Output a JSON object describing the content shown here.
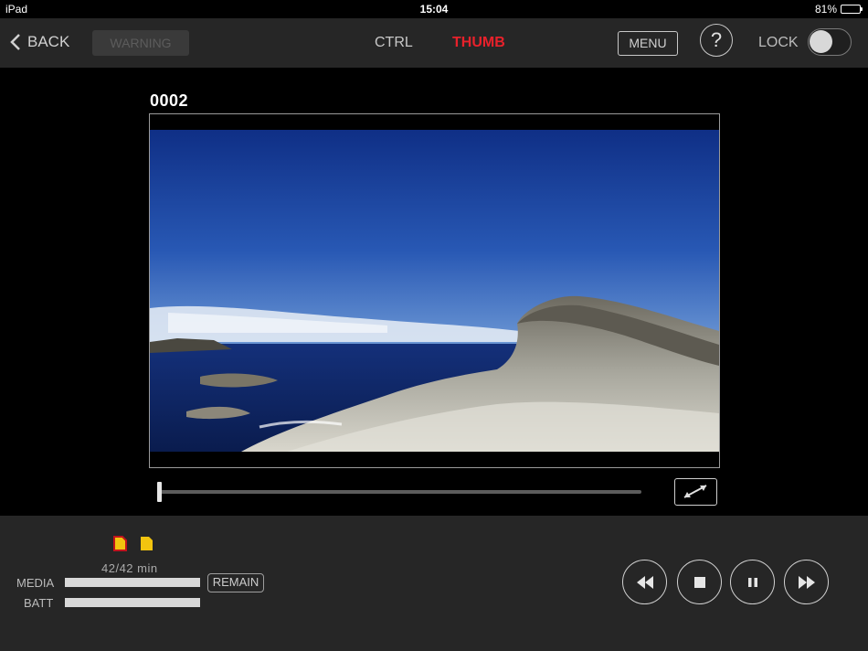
{
  "status_bar": {
    "device": "iPad",
    "time": "15:04",
    "battery_percent": "81%",
    "battery_level": 0.81
  },
  "nav": {
    "back_label": "BACK",
    "warning_label": "WARNING",
    "tabs": [
      {
        "label": "CTRL",
        "active": false
      },
      {
        "label": "THUMB",
        "active": true
      }
    ],
    "menu_label": "MENU",
    "help_label": "?",
    "lock_label": "LOCK",
    "lock_on": false
  },
  "clip": {
    "name": "0002",
    "playback_position": 0.0
  },
  "media": {
    "slots": [
      {
        "icon": "sd-card-icon",
        "color": "#f2c40f",
        "outline": "#c0141c",
        "selected": true
      },
      {
        "icon": "sd-card-icon",
        "color": "#f2c40f",
        "selected": false
      }
    ],
    "remain_text": "42/42 min",
    "media_label": "MEDIA",
    "batt_label": "BATT",
    "media_level": 1.0,
    "batt_level": 1.0,
    "remain_button": "REMAIN"
  },
  "transport": [
    "rewind-icon",
    "stop-icon",
    "pause-icon",
    "fast-forward-icon"
  ],
  "colors": {
    "accent_red": "#e8212b",
    "panel": "#262626",
    "background": "#000000"
  }
}
